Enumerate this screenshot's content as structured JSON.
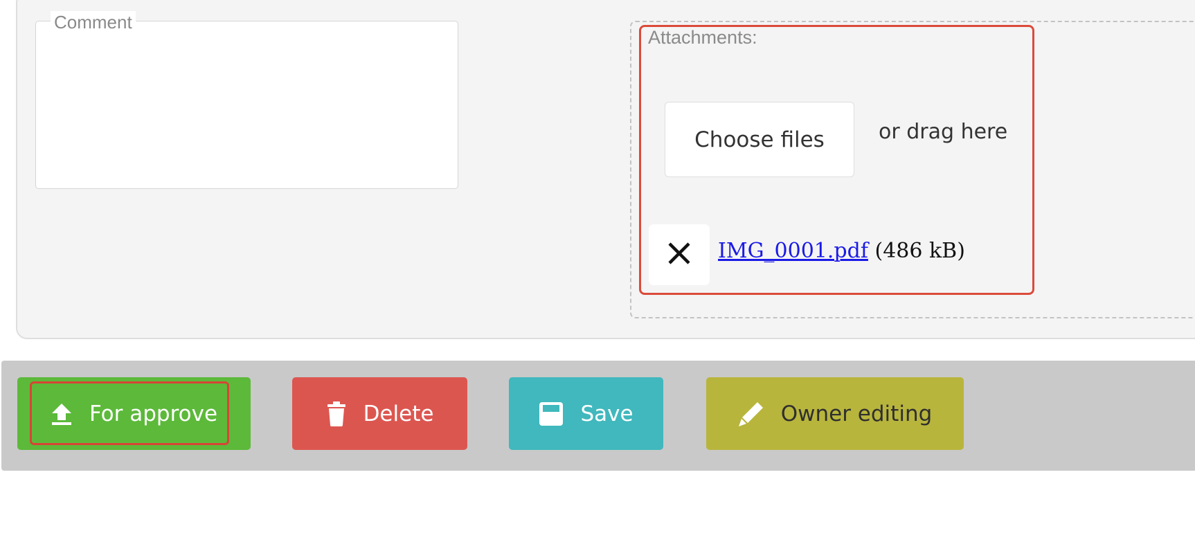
{
  "comment": {
    "label": "Comment",
    "value": ""
  },
  "attachments": {
    "title": "Attachments:",
    "choose_label": "Choose files",
    "drag_hint": "or drag here",
    "files": [
      {
        "name": "IMG_0001.pdf",
        "size": "(486 kB)"
      }
    ]
  },
  "actions": {
    "approve_label": "For approve",
    "delete_label": "Delete",
    "save_label": "Save",
    "owner_edit_label": "Owner editing"
  },
  "colors": {
    "approve": "#5cb93a",
    "delete": "#dc5650",
    "save": "#40b8bd",
    "owner_edit": "#b8b53d",
    "highlight": "#db4b3a",
    "link": "#1a1ae6"
  },
  "icons": {
    "approve": "upload-icon",
    "delete": "trash-icon",
    "save": "floppy-icon",
    "owner_edit": "pencil-icon",
    "remove_file": "close-icon"
  }
}
